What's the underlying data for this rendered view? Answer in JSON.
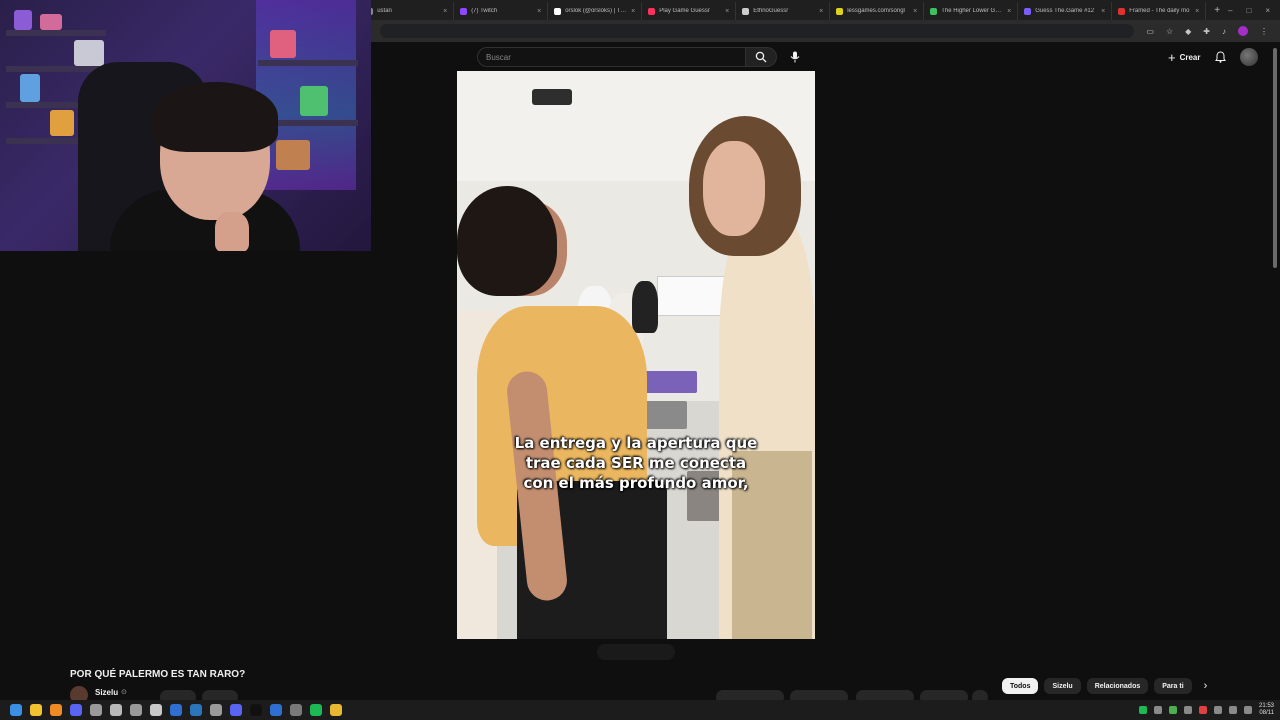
{
  "browser": {
    "tabs": [
      {
        "label": "ustan",
        "color": "#888888"
      },
      {
        "label": "(7) Twitch",
        "color": "#9146ff"
      },
      {
        "label": "orslok (@orsloks) | TikTok",
        "color": "#ffffff"
      },
      {
        "label": "Play Game Guessr",
        "color": "#ff2f5e"
      },
      {
        "label": "EthnoGuessr",
        "color": "#cccccc"
      },
      {
        "label": "lessgames.com/songl",
        "color": "#e0d21a"
      },
      {
        "label": "The Higher Lower Game",
        "color": "#3fbf5f"
      },
      {
        "label": "Guess The.Game #12",
        "color": "#7b5cff"
      },
      {
        "label": "Framed - The daily mo",
        "color": "#e03131"
      }
    ],
    "new_tab_symbol": "+",
    "window_controls": [
      "–",
      "□",
      "×"
    ]
  },
  "youtube": {
    "search": {
      "placeholder": "Buscar"
    },
    "create_label": "Crear",
    "icons": {
      "search": "search-icon",
      "mic": "mic-icon",
      "bell": "bell-icon",
      "plus": "plus-icon"
    }
  },
  "video": {
    "caption_lines": [
      "La entrega y la apertura que",
      "trae cada SER me conecta",
      "con el más profundo amor,"
    ]
  },
  "info": {
    "title": "POR QUÉ PALERMO ES TAN RARO?",
    "channel": "Sizelu",
    "verified_symbol": "⊙"
  },
  "chips": [
    "Todos",
    "Sizelu",
    "Relacionados",
    "Para ti"
  ],
  "chip_next_symbol": "›",
  "taskbar": {
    "apps": [
      "#3a8ee6",
      "#f2c230",
      "#f08a24",
      "#5865f2",
      "#9a9a9a",
      "#b8b8b8",
      "#9a9a9a",
      "#c9c9c9",
      "#2f6fd1",
      "#2a75bb",
      "#9a9a9a",
      "#5865f2",
      "#111111",
      "#2f6fd1",
      "#7a7a7a",
      "#1db954",
      "#e8b830"
    ],
    "clock_time": "21:53",
    "clock_date": "08/11"
  }
}
